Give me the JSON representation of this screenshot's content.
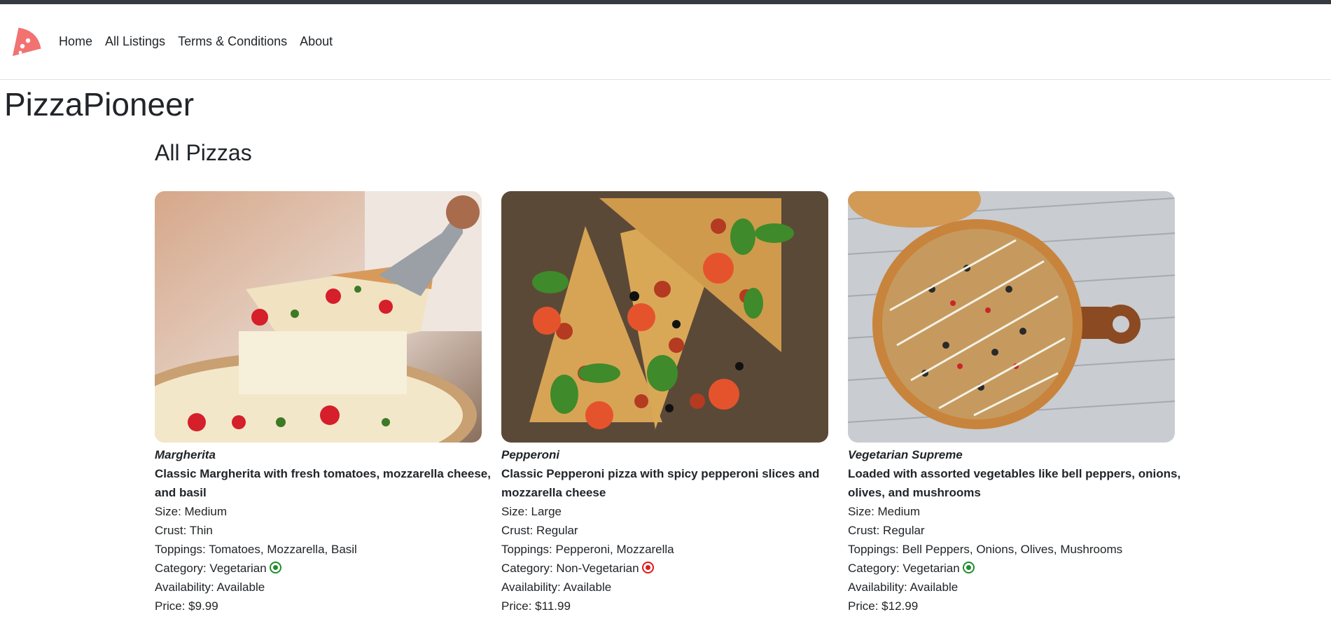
{
  "nav": {
    "logo_icon": "pizza-slice-icon",
    "links": [
      "Home",
      "All Listings",
      "Terms & Conditions",
      "About"
    ]
  },
  "site": {
    "title": "PizzaPioneer"
  },
  "section": {
    "title": "All Pizzas"
  },
  "pizzas": [
    {
      "name": "Margherita",
      "description": "Classic Margherita with fresh tomatoes, mozzarella cheese, and basil",
      "size_label": "Size: Medium",
      "crust_label": "Crust: Thin",
      "toppings_label": "Toppings: Tomatoes, Mozzarella, Basil",
      "category_label": "Category: Vegetarian",
      "category_icon": "veg-indicator-icon",
      "availability_label": "Availability: Available",
      "price_label": "Price: $9.99"
    },
    {
      "name": "Pepperoni",
      "description": "Classic Pepperoni pizza with spicy pepperoni slices and mozzarella cheese",
      "size_label": "Size: Large",
      "crust_label": "Crust: Regular",
      "toppings_label": "Toppings: Pepperoni, Mozzarella",
      "category_label": "Category: Non-Vegetarian",
      "category_icon": "non-veg-indicator-icon",
      "availability_label": "Availability: Available",
      "price_label": "Price: $11.99"
    },
    {
      "name": "Vegetarian Supreme",
      "description": "Loaded with assorted vegetables like bell peppers, onions, olives, and mushrooms",
      "size_label": "Size: Medium",
      "crust_label": "Crust: Regular",
      "toppings_label": "Toppings: Bell Peppers, Onions, Olives, Mushrooms",
      "category_label": "Category: Vegetarian",
      "category_icon": "veg-indicator-icon",
      "availability_label": "Availability: Available",
      "price_label": "Price: $12.99"
    }
  ],
  "colors": {
    "brand": "#f27272",
    "veg": "#1e8e2e",
    "non_veg": "#e01b1b"
  }
}
